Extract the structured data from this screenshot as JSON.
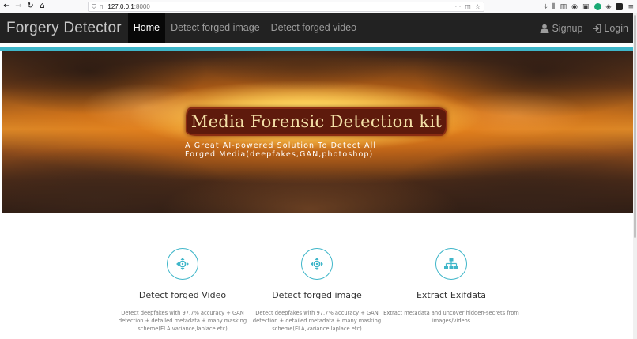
{
  "browser": {
    "url_host": "127.0.0.1",
    "url_port": ":8000"
  },
  "navbar": {
    "brand": "Forgery Detector",
    "links": [
      "Home",
      "Detect forged image",
      "Detect forged video"
    ],
    "active_index": 0,
    "signup_label": "Signup",
    "login_label": "Login"
  },
  "hero": {
    "title": "Media Forensic Detection kit",
    "subtitle_line1": "A Great AI-powered Solution To Detect All",
    "subtitle_line2": "Forged Media(deepfakes,GAN,photoshop)"
  },
  "services": [
    {
      "title": "Detect forged Video",
      "desc_line1": "Detect deepfakes with 97.7% accuracy + GAN",
      "desc_line2": "detection + detailed metadata + many masking",
      "desc_line3": "scheme(ELA,variance,laplace etc)",
      "icon": "crosshair-icon"
    },
    {
      "title": "Detect forged image",
      "desc_line1": "Detect deepfakes with 97.7% accuracy + GAN",
      "desc_line2": "detection + detailed metadata + many masking",
      "desc_line3": "scheme(ELA,variance,laplace etc)",
      "icon": "crosshair-icon"
    },
    {
      "title": "Extract Exifdata",
      "desc_line1": "Extract metadata and uncover hidden-secrets from",
      "desc_line2": "images/videos",
      "desc_line3": "",
      "icon": "sitemap-icon"
    }
  ],
  "colors": {
    "navbar_bg": "#222222",
    "accent_cyan": "#3fb6c9",
    "badge_bg": "#5e1a0c"
  }
}
